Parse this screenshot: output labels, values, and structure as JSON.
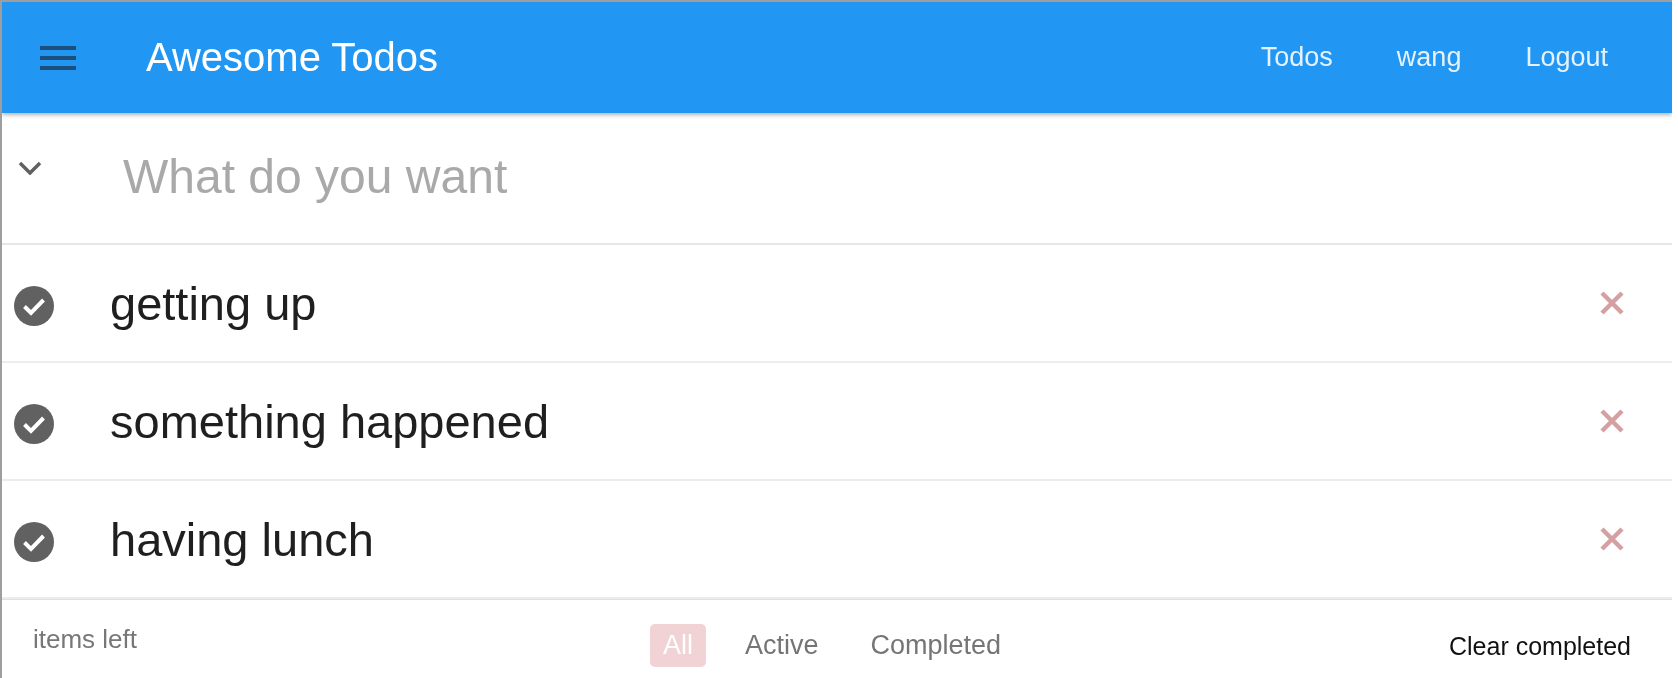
{
  "header": {
    "title": "Awesome Todos",
    "nav": [
      {
        "label": "Todos"
      },
      {
        "label": "wang"
      },
      {
        "label": "Logout"
      }
    ]
  },
  "new_todo": {
    "placeholder": "What do you want"
  },
  "todos": [
    {
      "text": "getting up",
      "completed": true
    },
    {
      "text": "something happened",
      "completed": true
    },
    {
      "text": "having lunch",
      "completed": true
    }
  ],
  "footer": {
    "count_label": "items left",
    "filters": [
      {
        "label": "All",
        "selected": true
      },
      {
        "label": "Active",
        "selected": false
      },
      {
        "label": "Completed",
        "selected": false
      }
    ],
    "clear_label": "Clear completed"
  }
}
